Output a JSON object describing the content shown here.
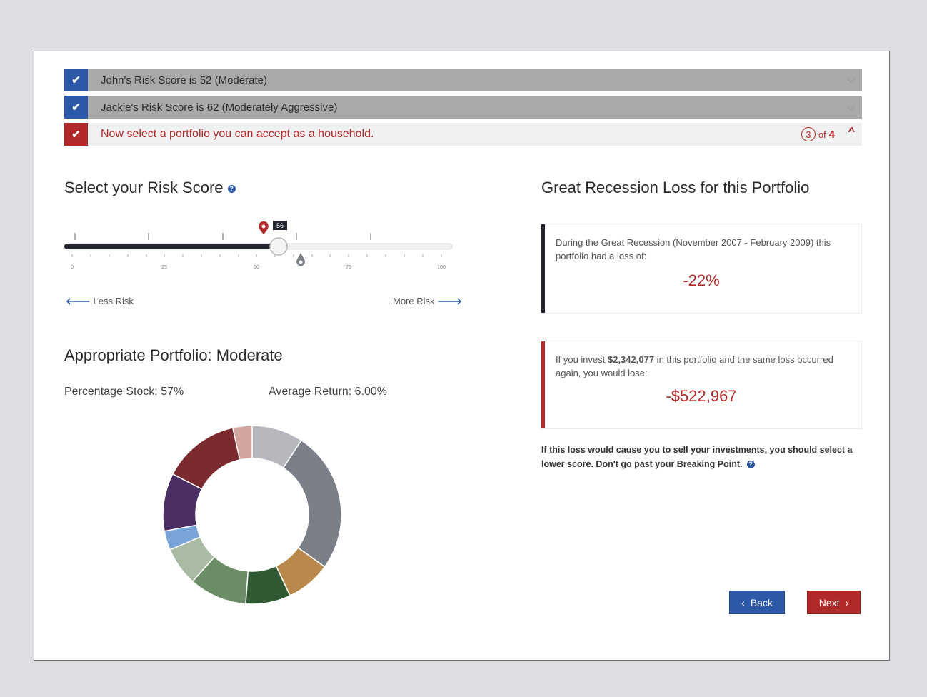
{
  "accordion": {
    "john": {
      "label": "John's Risk Score is 52 (Moderate)"
    },
    "jackie": {
      "label": "Jackie's Risk Score is 62 (Moderately Aggressive)"
    },
    "current": {
      "label": "Now select a portfolio you can accept as a household.",
      "step": "3",
      "of_text": "of",
      "total": "4"
    }
  },
  "risk_score": {
    "heading": "Select your Risk Score",
    "value": 56,
    "value_label": "56",
    "ticks": [
      "0",
      "25",
      "50",
      "75",
      "100"
    ],
    "less_risk": "Less Risk",
    "more_risk": "More Risk"
  },
  "portfolio": {
    "heading": "Appropriate Portfolio: Moderate",
    "percentage_stock": "Percentage Stock: 57%",
    "average_return": "Average Return: 6.00%"
  },
  "chart_data": {
    "type": "pie",
    "donut": true,
    "values": [
      8,
      22,
      7,
      7,
      9,
      6,
      3,
      9,
      12,
      3
    ],
    "colors": [
      "#b6b8bd",
      "#7b8088",
      "#b8894a",
      "#2f5a34",
      "#6b8c66",
      "#a9bba3",
      "#78a4d8",
      "#4b2e63",
      "#7b2a2f",
      "#d4a5a0"
    ]
  },
  "recession": {
    "heading": "Great Recession Loss for this Portfolio",
    "card1_text": "During the Great Recession (November 2007 - February 2009) this portfolio had a loss of:",
    "card1_value": "-22%",
    "card2_prefix": "If you invest ",
    "card2_amount": "$2,342,077",
    "card2_suffix": " in this portfolio and the same loss occurred again, you would lose:",
    "card2_value": "-$522,967",
    "note": "If this loss would cause you to sell your investments, you should select a lower score. Don't go past your Breaking Point."
  },
  "buttons": {
    "back": "Back",
    "next": "Next"
  },
  "colors": {
    "blue": "#2e59a8",
    "red": "#b02a2a",
    "dark": "#23262d"
  }
}
